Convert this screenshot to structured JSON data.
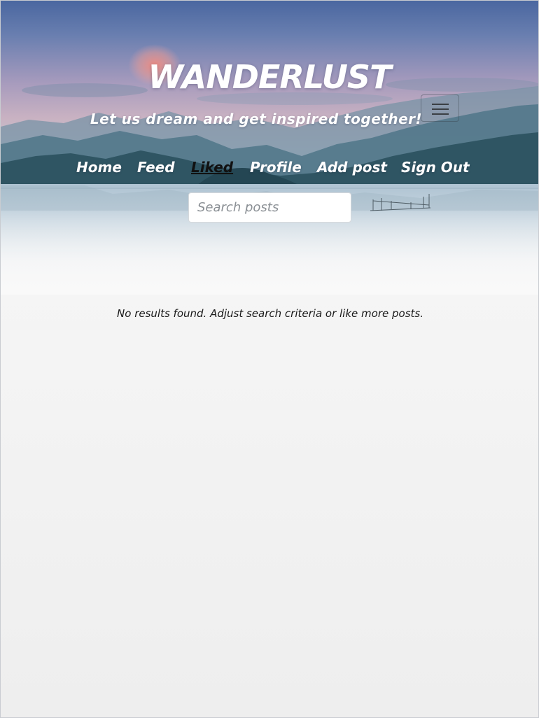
{
  "site": {
    "title": "WANDERLUST",
    "tagline": "Let us dream and get inspired together!"
  },
  "nav": {
    "items": [
      {
        "label": "Home",
        "active": false
      },
      {
        "label": "Feed",
        "active": false
      },
      {
        "label": "Liked",
        "active": true
      },
      {
        "label": "Profile",
        "active": false
      },
      {
        "label": "Add post",
        "active": false
      },
      {
        "label": "Sign Out",
        "active": false
      }
    ],
    "toggle_icon": "hamburger-menu-icon"
  },
  "search": {
    "placeholder": "Search posts",
    "value": ""
  },
  "results": {
    "empty_message": "No results found. Adjust search criteria or like more posts."
  },
  "colors": {
    "hero_sky_top": "#4f6ea3",
    "hero_sky_mid": "#c9a3b4",
    "mountain": "#3f6878",
    "water": "#b9cbd8",
    "page_bg": "#f4f4f4",
    "active_link": "#111111"
  }
}
